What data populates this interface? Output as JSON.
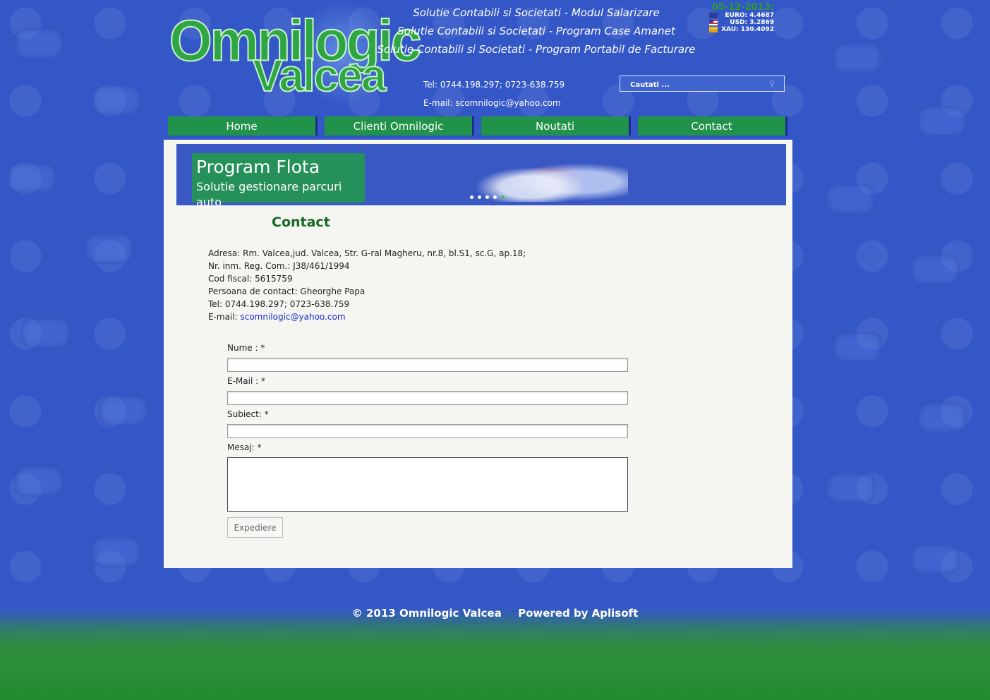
{
  "header": {
    "logo_line1": "Omnilogic",
    "logo_line2": "Valcea",
    "taglines": [
      "Solutie Contabili si Societati - Modul Salarizare",
      "Solutie Contabili si Societati - Program Case Amanet",
      "Solutie Contabili si Societati - Program Portabil de Facturare"
    ],
    "tel": "Tel: 0744.198.297; 0723-638.759",
    "email": "E-mail: scomnilogic@yahoo.com",
    "search_placeholder": "Cautati ...",
    "rates": {
      "date": "05-12-2013:",
      "euro": "EURO: 4.4687",
      "usd": "USD: 3.2869",
      "xau": "XAU: 130.4092"
    }
  },
  "nav": [
    "Home",
    "Clienti Omnilogic",
    "Noutati",
    "Contact"
  ],
  "banner": {
    "title": "Program Flota",
    "subtitle": "Solutie gestionare parcuri auto",
    "slides": 5,
    "active_slide": 5
  },
  "contact": {
    "title": "Contact",
    "lines": [
      "Adresa: Rm. Valcea,jud. Valcea, Str. G-ral Magheru, nr.8, bl.S1, sc.G, ap.18;",
      "Nr. inm. Reg. Com.: J38/461/1994",
      "Cod fiscal:  5615759",
      "Persoana de contact: Gheorghe Papa",
      "Tel:  0744.198.297; 0723-638.759"
    ],
    "email_label": "E-mail: ",
    "email_link": "scomnilogic@yahoo.com"
  },
  "form": {
    "name_label": "Nume : *",
    "email_label": "E-Mail : *",
    "subject_label": "Subiect: *",
    "message_label": "Mesaj: *",
    "submit": "Expediere"
  },
  "footer": {
    "copyright": "© 2013 Omnilogic Valcea",
    "powered": "Powered by Aplisoft"
  }
}
